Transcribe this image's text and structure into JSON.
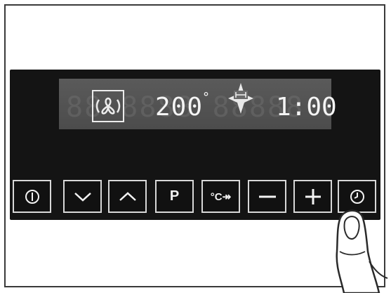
{
  "display": {
    "temperature": "200",
    "degree_symbol": "°",
    "time": "1:00",
    "fan_mode_icon": "fan-icon",
    "heat_indicator_icon": "star-heat-icon"
  },
  "buttons": [
    {
      "id": "power",
      "icon": "power-icon",
      "label": ""
    },
    {
      "id": "down",
      "icon": "chevron-down-icon",
      "label": ""
    },
    {
      "id": "up",
      "icon": "chevron-up-icon",
      "label": ""
    },
    {
      "id": "program",
      "icon": "",
      "label": "P"
    },
    {
      "id": "fast-heat",
      "icon": "",
      "label": "°C↠"
    },
    {
      "id": "minus",
      "icon": "minus-icon",
      "label": ""
    },
    {
      "id": "plus",
      "icon": "plus-icon",
      "label": ""
    },
    {
      "id": "clock",
      "icon": "clock-icon",
      "label": ""
    }
  ],
  "colors": {
    "panel": "#141414",
    "display_background": "#555555",
    "segment_lit": "#f4f4f4",
    "button_border": "#d8d8d8"
  }
}
